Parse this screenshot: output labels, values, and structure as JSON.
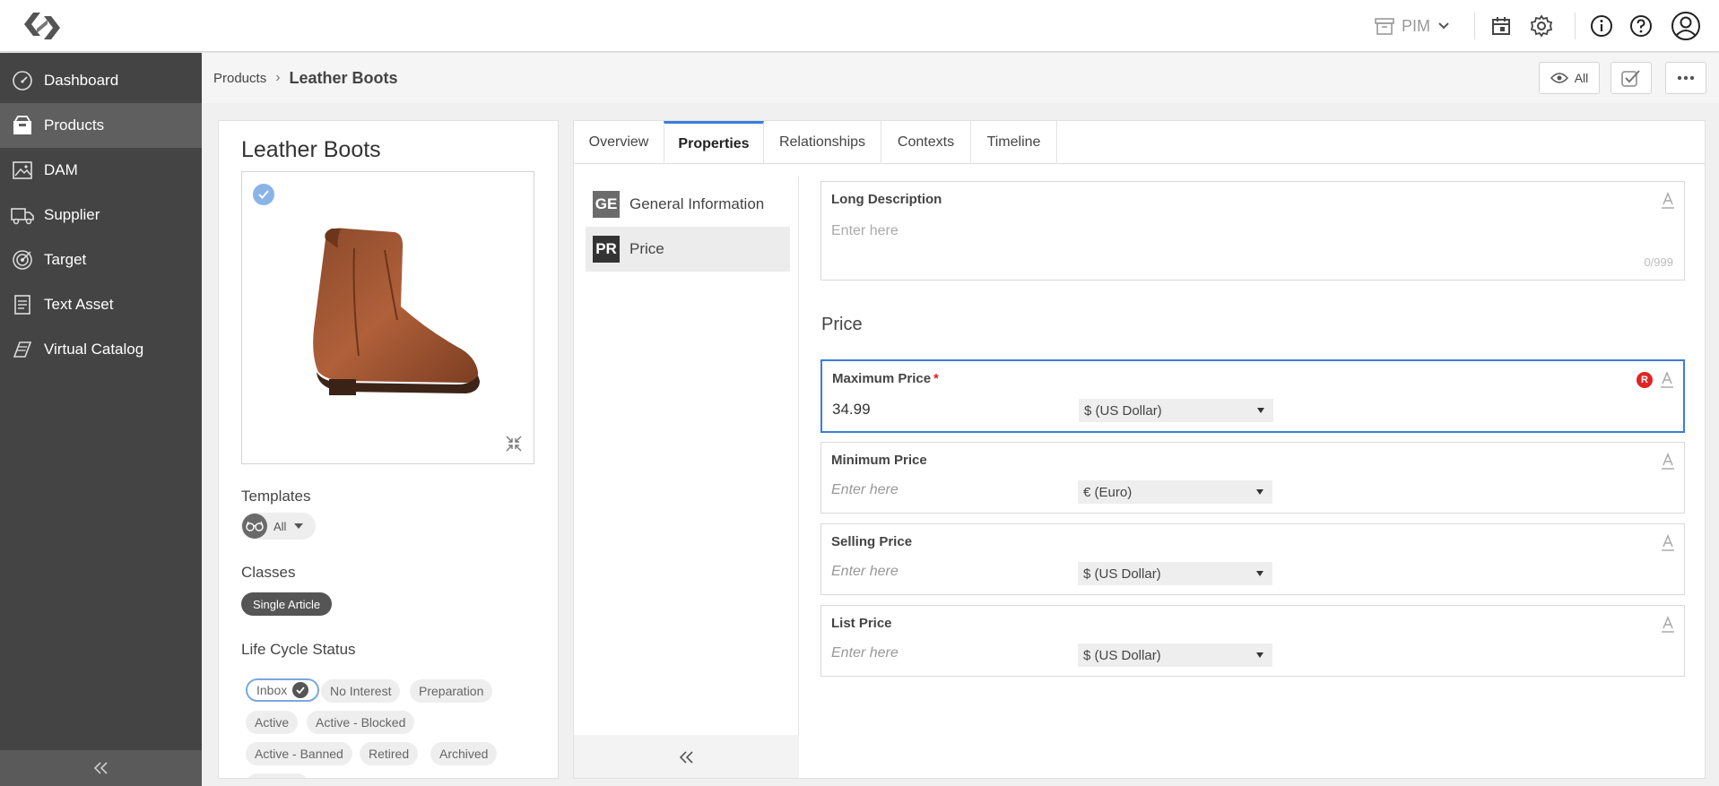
{
  "topbar": {
    "pim_label": "PIM"
  },
  "sidebar": {
    "items": [
      {
        "label": "Dashboard",
        "icon": "gauge-icon"
      },
      {
        "label": "Products",
        "icon": "box-icon"
      },
      {
        "label": "DAM",
        "icon": "image-icon"
      },
      {
        "label": "Supplier",
        "icon": "truck-icon"
      },
      {
        "label": "Target",
        "icon": "target-icon"
      },
      {
        "label": "Text Asset",
        "icon": "document-icon"
      },
      {
        "label": "Virtual Catalog",
        "icon": "catalog-icon"
      }
    ],
    "active": "Products"
  },
  "breadcrumb": {
    "root": "Products",
    "separator": "›",
    "current": "Leather Boots"
  },
  "header": {
    "view_label": "All"
  },
  "product": {
    "title": "Leather Boots",
    "templates_label": "Templates",
    "templates_value": "All",
    "classes_label": "Classes",
    "classes": [
      "Single Article"
    ],
    "lifecycle_label": "Life Cycle Status",
    "lifecycle": [
      {
        "label": "Inbox",
        "selected": true
      },
      {
        "label": "No Interest",
        "selected": false
      },
      {
        "label": "Preparation",
        "selected": false
      },
      {
        "label": "Active",
        "selected": false
      },
      {
        "label": "Active - Blocked",
        "selected": false
      },
      {
        "label": "Retired",
        "selected": false
      },
      {
        "label": "Active - Banned",
        "selected": false
      },
      {
        "label": "Archived",
        "selected": false
      }
    ]
  },
  "tabs": [
    {
      "label": "Overview",
      "active": false
    },
    {
      "label": "Properties",
      "active": true
    },
    {
      "label": "Relationships",
      "active": false
    },
    {
      "label": "Contexts",
      "active": false
    },
    {
      "label": "Timeline",
      "active": false
    }
  ],
  "groups": [
    {
      "badge": "GE",
      "label": "General Information",
      "badge_color": "#6b6b6b",
      "active": false
    },
    {
      "badge": "PR",
      "label": "Price",
      "badge_color": "#333333",
      "active": true
    }
  ],
  "long_description": {
    "label": "Long Description",
    "placeholder": "Enter here",
    "counter": "0/999"
  },
  "price_section": {
    "title": "Price",
    "fields": [
      {
        "label": "Maximum Price",
        "required": "*",
        "value": "34.99",
        "currency": "$ (US Dollar)",
        "badge": "R"
      },
      {
        "label": "Minimum Price",
        "placeholder": "Enter here",
        "currency": "€ (Euro)"
      },
      {
        "label": "Selling Price",
        "placeholder": "Enter here",
        "currency": "$ (US Dollar)"
      },
      {
        "label": "List Price",
        "placeholder": "Enter here",
        "currency": "$ (US Dollar)"
      }
    ]
  },
  "colors": {
    "accent": "#3b7dd8",
    "sidebar": "#444444",
    "required": "#dd2222"
  }
}
